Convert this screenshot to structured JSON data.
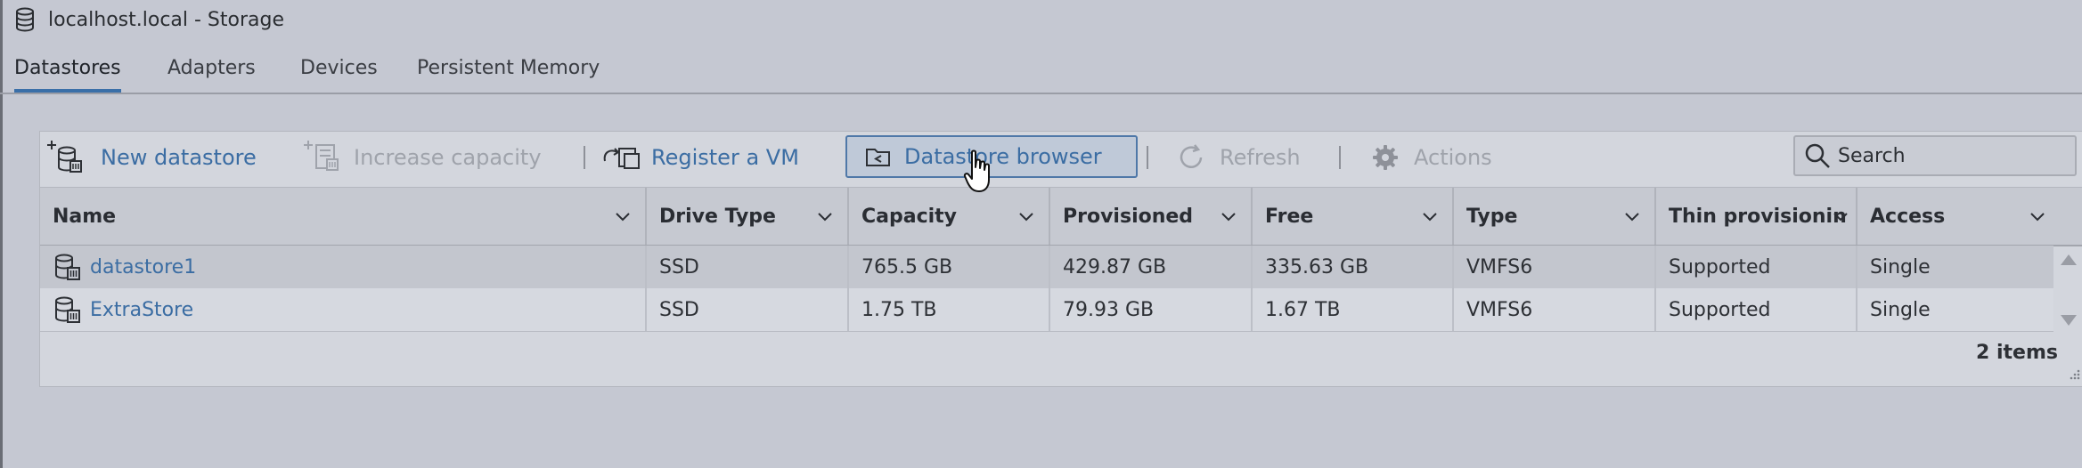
{
  "window": {
    "title": "localhost.local - Storage",
    "title_icon": "database-icon"
  },
  "tabs": [
    {
      "label": "Datastores",
      "active": true
    },
    {
      "label": "Adapters",
      "active": false
    },
    {
      "label": "Devices",
      "active": false
    },
    {
      "label": "Persistent Memory",
      "active": false
    }
  ],
  "toolbar": {
    "new_datastore": {
      "label": "New datastore",
      "icon": "new-datastore-icon",
      "enabled": true
    },
    "increase_capacity": {
      "label": "Increase capacity",
      "icon": "increase-capacity-icon",
      "enabled": false
    },
    "register_vm": {
      "label": "Register a VM",
      "icon": "register-vm-icon",
      "enabled": true
    },
    "datastore_browser": {
      "label": "Datastore browser",
      "icon": "datastore-browser-icon",
      "enabled": true,
      "hovered": true
    },
    "refresh": {
      "label": "Refresh",
      "icon": "refresh-icon",
      "enabled": false
    },
    "actions": {
      "label": "Actions",
      "icon": "gear-icon",
      "enabled": false
    }
  },
  "search": {
    "placeholder": "Search",
    "value": ""
  },
  "table": {
    "columns": [
      "Name",
      "Drive Type",
      "Capacity",
      "Provisioned",
      "Free",
      "Type",
      "Thin provisioning",
      "Access"
    ],
    "rows": [
      {
        "name": "datastore1",
        "drive_type": "SSD",
        "capacity": "765.5 GB",
        "provisioned": "429.87 GB",
        "free": "335.63 GB",
        "type": "VMFS6",
        "thin_provisioning": "Supported",
        "access": "Single"
      },
      {
        "name": "ExtraStore",
        "drive_type": "SSD",
        "capacity": "1.75 TB",
        "provisioned": "79.93 GB",
        "free": "1.67 TB",
        "type": "VMFS6",
        "thin_provisioning": "Supported",
        "access": "Single"
      }
    ],
    "footer": "2 items"
  },
  "colors": {
    "link": "#3b6da3",
    "disabled": "#9fa3ab",
    "tab_active": "#3a6fa8",
    "background": "#c5c8d2"
  }
}
